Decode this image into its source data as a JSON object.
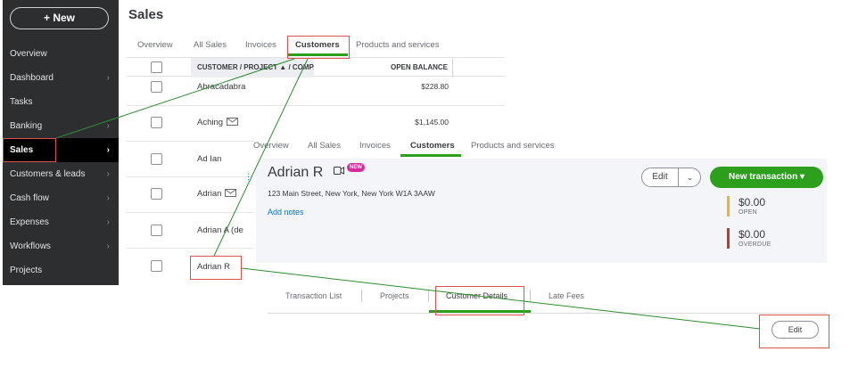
{
  "sidebar": {
    "new_label": "+  New",
    "items": [
      {
        "label": "Overview",
        "chevron": false
      },
      {
        "label": "Dashboard",
        "chevron": true
      },
      {
        "label": "Tasks",
        "chevron": false
      },
      {
        "label": "Banking",
        "chevron": true
      },
      {
        "label": "Sales",
        "chevron": true,
        "active": true
      },
      {
        "label": "Customers & leads",
        "chevron": true
      },
      {
        "label": "Cash flow",
        "chevron": true
      },
      {
        "label": "Expenses",
        "chevron": true
      },
      {
        "label": "Workflows",
        "chevron": true
      },
      {
        "label": "Projects",
        "chevron": false
      }
    ],
    "chevron_glyph": "›"
  },
  "page": {
    "title": "Sales",
    "tabs": [
      "Overview",
      "All Sales",
      "Invoices",
      "Customers",
      "Products and services"
    ],
    "active_tab": "Customers"
  },
  "table": {
    "col_name": "CUSTOMER / PROJECT ▲ / COMPANY",
    "col_balance": "OPEN BALANCE",
    "rows": [
      {
        "name": "Abracadabra",
        "balance": "$228.80",
        "mail": false
      },
      {
        "name": "Aching",
        "balance": "$1,145.00",
        "mail": true
      },
      {
        "name": "Ad Ian",
        "balance": "",
        "mail": false
      },
      {
        "name": "Adrian",
        "balance": "",
        "mail": true
      },
      {
        "name": "Adrian A (de",
        "balance": "",
        "mail": false
      },
      {
        "name": "Adrian R",
        "balance": "",
        "mail": false
      }
    ]
  },
  "detail": {
    "tabs": [
      "Overview",
      "All Sales",
      "Invoices",
      "Customers",
      "Products and services"
    ],
    "active_tab": "Customers",
    "customer_name": "Adrian R",
    "new_badge": "NEW",
    "address": "123 Main Street, New York, New York W1A 3AAW",
    "add_notes": "Add notes",
    "edit_label": "Edit",
    "dropdown_glyph": "⌄",
    "new_transaction_label": "New transaction  ▾",
    "open_amount": "$0.00",
    "open_label": "OPEN",
    "overdue_amount": "$0.00",
    "overdue_label": "OVERDUE",
    "sub_tabs": [
      "Transaction List",
      "Projects",
      "Customer Details",
      "Late Fees"
    ],
    "active_sub_tab": "Customer Details",
    "edit2_label": "Edit",
    "dots": "⋮"
  },
  "colors": {
    "accent_green": "#2ca01c",
    "annotation_red": "#e05050",
    "annotation_line": "#2e8b2e",
    "open_bar": "#f0b429",
    "overdue_bar": "#c0392b",
    "badge_pink": "#d52b9c"
  }
}
